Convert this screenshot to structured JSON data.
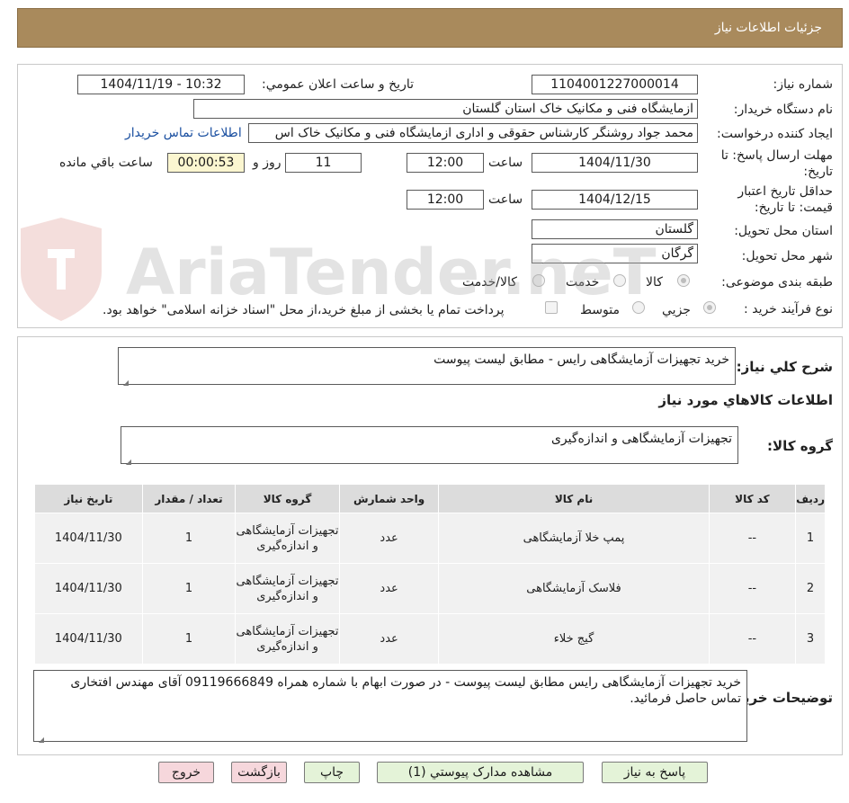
{
  "header": {
    "title": "جزئیات اطلاعات نیاز"
  },
  "form": {
    "need_number_label": "شماره نیاز:",
    "need_number": "1104001227000014",
    "announce_label": "تاريخ و ساعت اعلان عمومي:",
    "announce_value": "1404/11/19 - 10:32",
    "buyer_label": "نام دستگاه خريدار:",
    "buyer_value": "ازمایشگاه فنی و مکانیک خاک استان گلستان",
    "creator_label": "ايجاد کننده درخواست:",
    "creator_value": "محمد جواد روشنگر کارشناس حقوقی و اداری ازمایشگاه فنی و مکانیک خاک اس",
    "contact_link": "اطلاعات تماس خريدار",
    "deadline_label_1": "مهلت ارسال پاسخ: تا",
    "deadline_label_2": "تاريخ:",
    "deadline_date": "1404/11/30",
    "time_label": "ساعت",
    "deadline_time": "12:00",
    "days_value": "11",
    "days_label": "روز و",
    "remaining_value": "00:00:53",
    "remaining_label": "ساعت باقي مانده",
    "validity_label_1": "حداقل تاريخ اعتبار",
    "validity_label_2": "قيمت: تا تاريخ:",
    "validity_date": "1404/12/15",
    "validity_time": "12:00",
    "province_label": "استان محل تحويل:",
    "province_value": "گلستان",
    "city_label": "شهر محل تحويل:",
    "city_value": "گرگان",
    "category_label": "طبقه بندی موضوعی:",
    "category_options": [
      "کالا",
      "خدمت",
      "کالا/خدمت"
    ],
    "process_label": "نوع فرآيند خريد :",
    "process_options": [
      "جزيي",
      "متوسط"
    ],
    "payment_note": "پرداخت تمام يا بخشی از مبلغ خريد،از محل \"اسناد خزانه اسلامی\" خواهد بود."
  },
  "summary": {
    "label": "شرح کلي نياز:",
    "value": "خرید تجهیزات آزمایشگاهی رایس - مطابق لیست پیوست"
  },
  "goods": {
    "title": "اطلاعات کالاهاي مورد نياز",
    "group_label": "گروه کالا:",
    "group_value": "تجهیزات آزمایشگاهی و اندازه‌گیری",
    "columns": [
      "رديف",
      "کد کالا",
      "نام کالا",
      "واحد شمارش",
      "گروه کالا",
      "تعداد / مقدار",
      "تاريخ نياز"
    ],
    "rows": [
      {
        "index": "1",
        "code": "--",
        "name": "پمپ خلا آزمایشگاهی",
        "unit": "عدد",
        "group": "تجهیزات آزمایشگاهی و اندازه‌گیری",
        "qty": "1",
        "date": "1404/11/30"
      },
      {
        "index": "2",
        "code": "--",
        "name": "فلاسک آزمایشگاهی",
        "unit": "عدد",
        "group": "تجهیزات آزمایشگاهی و اندازه‌گیری",
        "qty": "1",
        "date": "1404/11/30"
      },
      {
        "index": "3",
        "code": "--",
        "name": "گیج خلاء",
        "unit": "عدد",
        "group": "تجهیزات آزمایشگاهی و اندازه‌گیری",
        "qty": "1",
        "date": "1404/11/30"
      }
    ]
  },
  "buyer_notes": {
    "label": "توضيحات خريدار:",
    "value": "خرید تجهیزات آزمایشگاهی رایس مطابق لیست پیوست - در صورت ابهام با شماره همراه 09119666849 آقای مهندس افتخاری تماس حاصل فرمائید."
  },
  "buttons": {
    "reply": "پاسخ به نياز",
    "attachments": "مشاهده مدارک پيوستي (1)",
    "print": "چاپ",
    "back": "بازگشت",
    "exit": "خروج"
  },
  "watermark": {
    "text": "AriaTender.neT"
  }
}
